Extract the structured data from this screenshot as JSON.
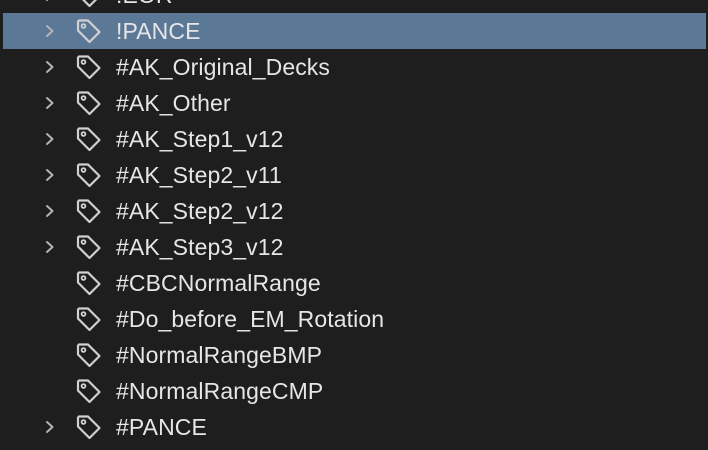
{
  "tag_tree": {
    "items": [
      {
        "label": "!EOR",
        "expandable": true,
        "selected": false
      },
      {
        "label": "!PANCE",
        "expandable": true,
        "selected": true
      },
      {
        "label": "#AK_Original_Decks",
        "expandable": true,
        "selected": false
      },
      {
        "label": "#AK_Other",
        "expandable": true,
        "selected": false
      },
      {
        "label": "#AK_Step1_v12",
        "expandable": true,
        "selected": false
      },
      {
        "label": "#AK_Step2_v11",
        "expandable": true,
        "selected": false
      },
      {
        "label": "#AK_Step2_v12",
        "expandable": true,
        "selected": false
      },
      {
        "label": "#AK_Step3_v12",
        "expandable": true,
        "selected": false
      },
      {
        "label": "#CBCNormalRange",
        "expandable": false,
        "selected": false
      },
      {
        "label": "#Do_before_EM_Rotation",
        "expandable": false,
        "selected": false
      },
      {
        "label": "#NormalRangeBMP",
        "expandable": false,
        "selected": false
      },
      {
        "label": "#NormalRangeCMP",
        "expandable": false,
        "selected": false
      },
      {
        "label": "#PANCE",
        "expandable": true,
        "selected": false
      }
    ]
  },
  "colors": {
    "background": "#1e1e1e",
    "selected_row": "#5b7896",
    "text": "#e6e6e6",
    "icon": "#d0d0d0",
    "chevron": "#b4b4b4"
  },
  "icons": {
    "chevron": "chevron-right-icon",
    "tag": "tag-icon"
  }
}
